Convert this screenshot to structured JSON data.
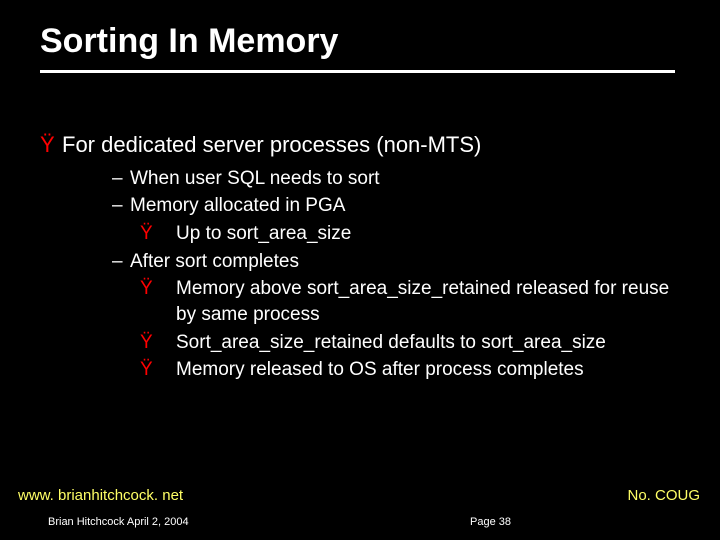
{
  "title": "Sorting In Memory",
  "bullets": {
    "l1": "For dedicated server processes (non-MTS)",
    "l2a": "When user SQL needs to sort",
    "l2b": "Memory allocated in PGA",
    "l3a": "Up to sort_area_size",
    "l2c": "After sort completes",
    "l3b": "Memory above sort_area_size_retained released for reuse by same process",
    "l3c": "Sort_area_size_retained defaults to sort_area_size",
    "l3d": "Memory released to OS after process completes"
  },
  "footer": {
    "url": "www. brianhitchcock. net",
    "org": "No. COUG",
    "author": "Brian Hitchcock  April 2, 2004",
    "page": "Page 38"
  },
  "glyphs": {
    "y": "Ÿ",
    "dash": "–"
  }
}
